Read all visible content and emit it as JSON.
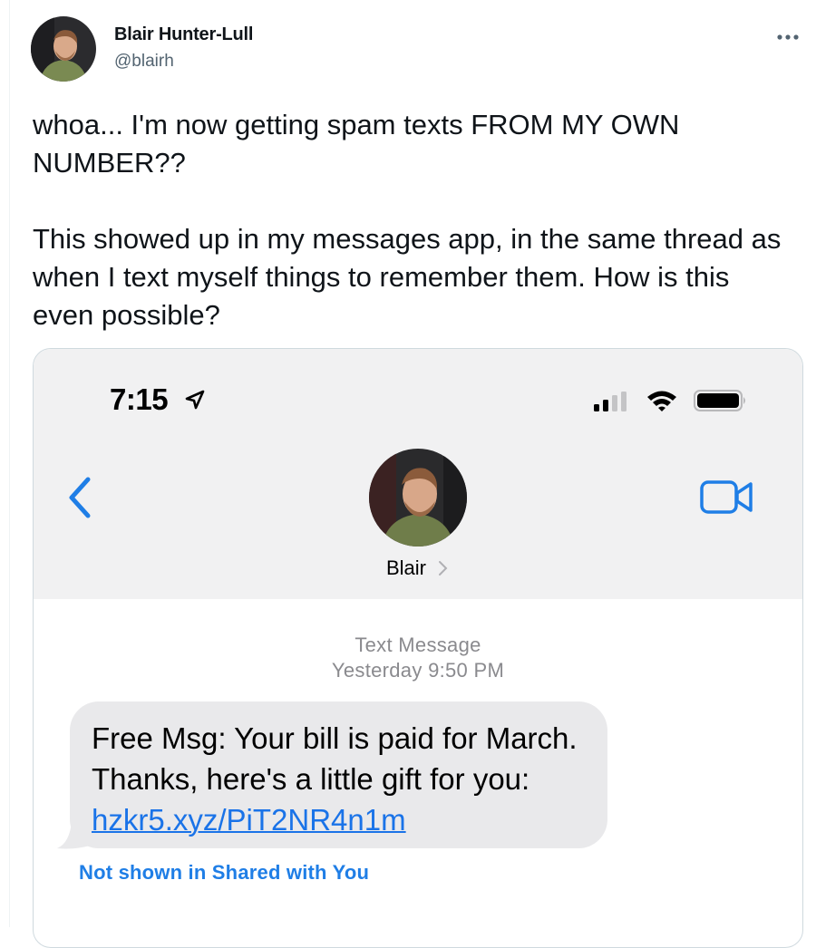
{
  "tweet": {
    "author_name": "Blair Hunter-Lull",
    "author_handle": "@blairh",
    "paragraph_1": "whoa... I'm now getting spam texts FROM MY OWN NUMBER??",
    "paragraph_2": "This showed up in my messages app, in the same thread as when I text myself things to remember them. How is this even possible?",
    "more_icon": "more-horizontal-icon"
  },
  "screenshot": {
    "status_time": "7:15",
    "contact_name": "Blair",
    "message_type": "Text Message",
    "message_day": "Yesterday",
    "message_time": "9:50 PM",
    "message_text": "Free Msg: Your bill is paid for March. Thanks, here's a little gift for you:",
    "message_link": "hzkr5.xyz/PiT2NR4n1m",
    "shared_note": "Not shown in Shared with You",
    "colors": {
      "ios_blue": "#1f7ee6",
      "bubble": "#e9e9eb",
      "header_bg": "#f1f1f2"
    },
    "icons": [
      "location-arrow-icon",
      "signal-icon",
      "wifi-icon",
      "battery-icon",
      "back-chevron-icon",
      "video-camera-icon"
    ]
  }
}
